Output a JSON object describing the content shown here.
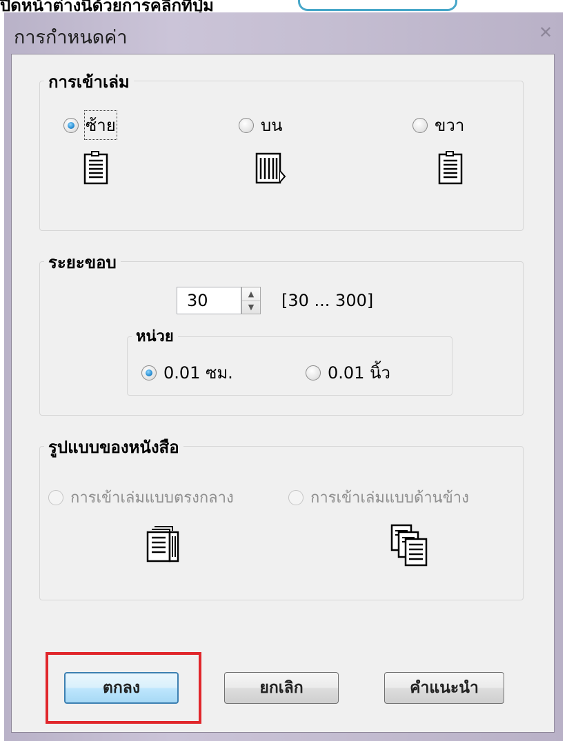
{
  "top_strip": {
    "text": "ปีดหน้าต่างนี้ด้วยการคลิกที่ปุ่ม"
  },
  "window": {
    "title": "การกำหนดค่า",
    "close_icon": "close-icon"
  },
  "binding": {
    "title": "การเข้าเล่ม",
    "options": [
      {
        "label": "ซ้าย",
        "checked": true,
        "icon": "document-binding-left-icon"
      },
      {
        "label": "บน",
        "checked": false,
        "icon": "document-binding-top-icon"
      },
      {
        "label": "ขวา",
        "checked": false,
        "icon": "document-binding-right-icon"
      }
    ]
  },
  "margin": {
    "title": "ระยะขอบ",
    "value": "30",
    "range": "[30 ... 300]",
    "unit_group": {
      "title": "หน่วย",
      "options": [
        {
          "label": "0.01 ซม.",
          "checked": true
        },
        {
          "label": "0.01 นิ้ว",
          "checked": false
        }
      ]
    }
  },
  "book_format": {
    "title": "รูปแบบของหนังสือ",
    "options": [
      {
        "label": "การเข้าเล่มแบบตรงกลาง",
        "enabled": false,
        "icon": "center-binding-booklet-icon"
      },
      {
        "label": "การเข้าเล่มแบบด้านข้าง",
        "enabled": false,
        "icon": "side-binding-booklet-icon"
      }
    ]
  },
  "buttons": {
    "ok": "ตกลง",
    "cancel": "ยกเลิก",
    "help": "คำแนะนำ"
  },
  "colors": {
    "highlight": "#e0262b",
    "default_button_border": "#3c7fb1",
    "radio_selected": "#2a8fd3"
  }
}
